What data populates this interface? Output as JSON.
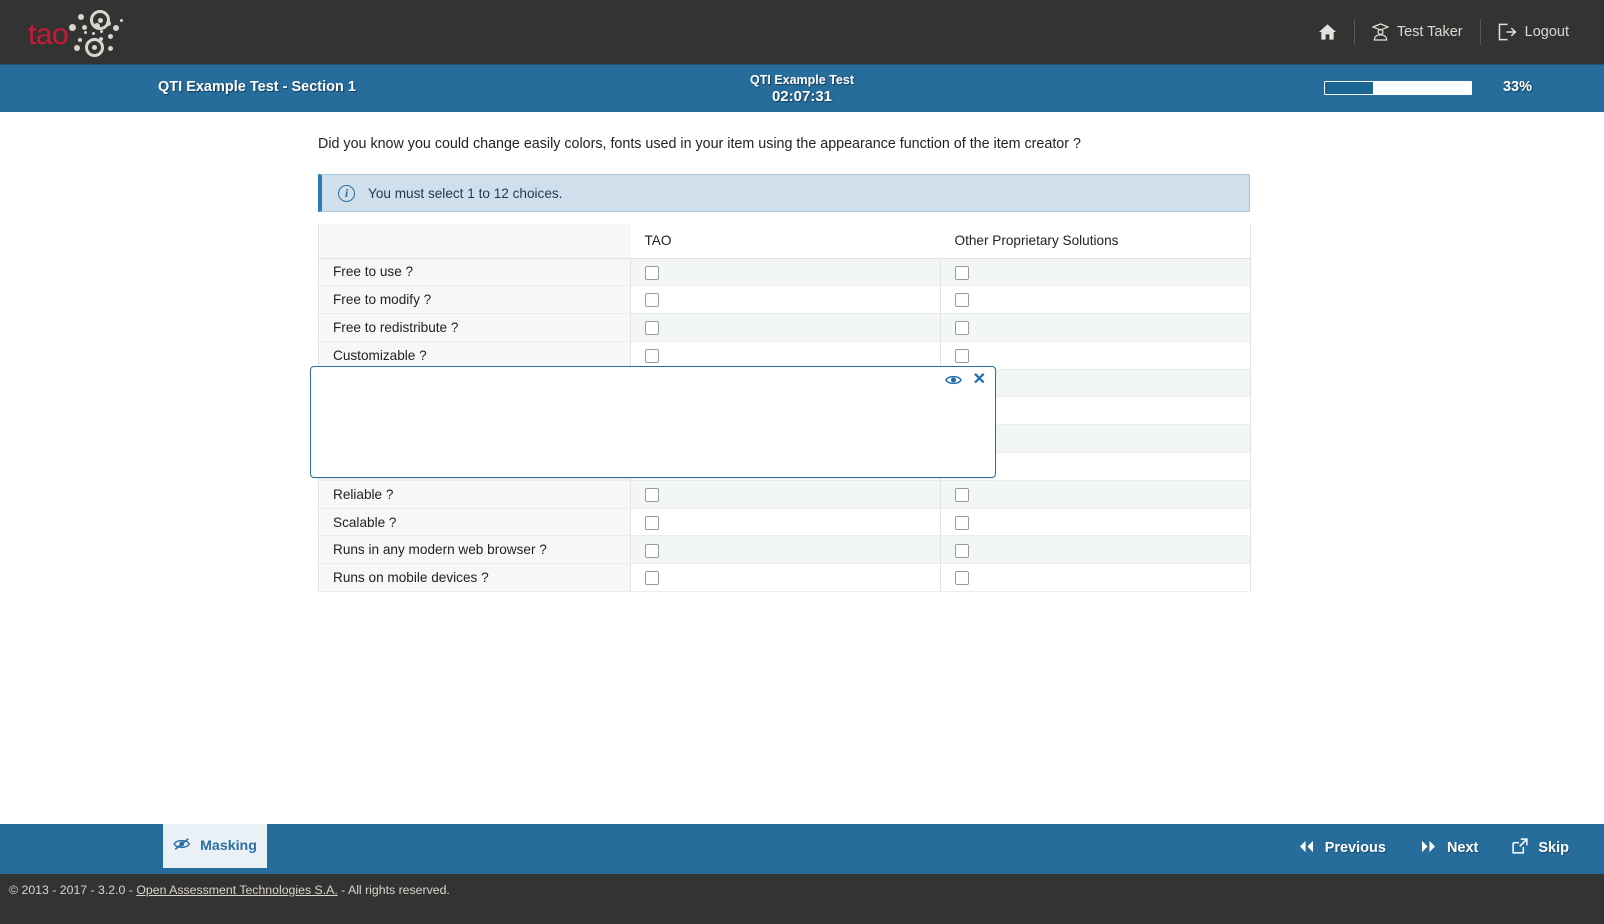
{
  "header": {
    "logo_text": "tao",
    "home_icon": "home-icon",
    "testtaker_label": "Test Taker",
    "testtaker_icon": "graduate-user-icon",
    "logout_label": "Logout",
    "logout_icon": "logout-icon"
  },
  "testbar": {
    "section_title": "QTI Example Test - Section 1",
    "test_name": "QTI Example Test",
    "timer": "02:07:31",
    "progress_percent_label": "33%",
    "progress_value": 33,
    "bar_fill_color": "#1b6593",
    "bar_bg_color": "#ffffff",
    "bar_color": "#266d9c"
  },
  "item": {
    "prompt": "Did you know you could change easily colors, fonts used in your item using the appearance function of the item creator ?",
    "info_icon": "info-circle-icon",
    "info_message": "You must select 1 to 12 choices.",
    "info_bg_color": "#cfe0ec",
    "info_accent_color": "#2d7ab0"
  },
  "table": {
    "headers": [
      "",
      "TAO",
      "Other Proprietary Solutions"
    ],
    "rows": [
      {
        "label": "Free to use ?",
        "tao": false,
        "other": false
      },
      {
        "label": "Free to modify ?",
        "tao": false,
        "other": false
      },
      {
        "label": "Free to redistribute ?",
        "tao": false,
        "other": false
      },
      {
        "label": "Customizable ?",
        "tao": false,
        "other": false
      },
      {
        "label": "",
        "tao": false,
        "other": false
      },
      {
        "label": "",
        "tao": false,
        "other": false
      },
      {
        "label": "",
        "tao": false,
        "other": false
      },
      {
        "label": "",
        "tao": false,
        "other": false
      },
      {
        "label": "Reliable ?",
        "tao": false,
        "other": false
      },
      {
        "label": "Scalable ?",
        "tao": false,
        "other": false
      },
      {
        "label": "Runs in any modern web browser ?",
        "tao": false,
        "other": false
      },
      {
        "label": "Runs on mobile devices ?",
        "tao": false,
        "other": false
      }
    ]
  },
  "mask": {
    "reveal_icon": "eye-icon",
    "close_icon": "close-x-icon",
    "close_label": "✕",
    "border_color": "#2b6d9c"
  },
  "actionbar": {
    "masking_label": "Masking",
    "masking_icon": "eye-slash-icon",
    "previous_label": "Previous",
    "previous_icon": "double-chevron-left-icon",
    "next_label": "Next",
    "next_icon": "double-chevron-right-icon",
    "skip_label": "Skip",
    "skip_icon": "external-link-icon"
  },
  "footer": {
    "prefix": "© 2013 - 2017 - 3.2.0 - ",
    "link": "Open Assessment Technologies S.A.",
    "suffix": " - All rights reserved."
  }
}
